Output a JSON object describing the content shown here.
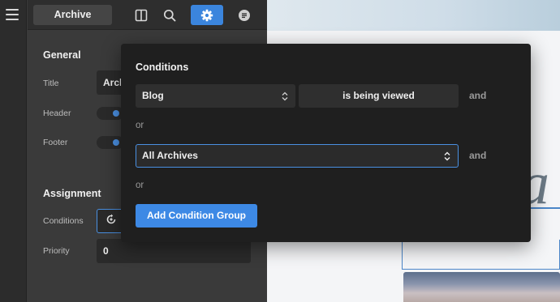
{
  "rail": {
    "menu_icon": "hamburger-icon"
  },
  "topbar": {
    "archive_tab": "Archive",
    "icons": [
      "layout-columns-icon",
      "search-icon",
      "gear-icon",
      "document-icon"
    ],
    "active_icon": "gear-icon",
    "accent": "#3b85dd"
  },
  "panel": {
    "general_title": "General",
    "title_label": "Title",
    "title_value": "Archi",
    "header_label": "Header",
    "header_on": true,
    "footer_label": "Footer",
    "footer_on": true,
    "assignment_title": "Assignment",
    "conditions_label": "Conditions",
    "conditions_icon": "refresh-plus-icon",
    "priority_label": "Priority",
    "priority_value": "0"
  },
  "popover": {
    "title": "Conditions",
    "group1": {
      "select_value": "Blog",
      "state_value": "is being viewed",
      "and_label": "and"
    },
    "or_label_1": "or",
    "group2": {
      "select_value": "All Archives",
      "and_label": "and"
    },
    "or_label_2": "or",
    "add_group_button": "Add Condition Group"
  },
  "preview": {
    "heading_fragment": "a"
  }
}
